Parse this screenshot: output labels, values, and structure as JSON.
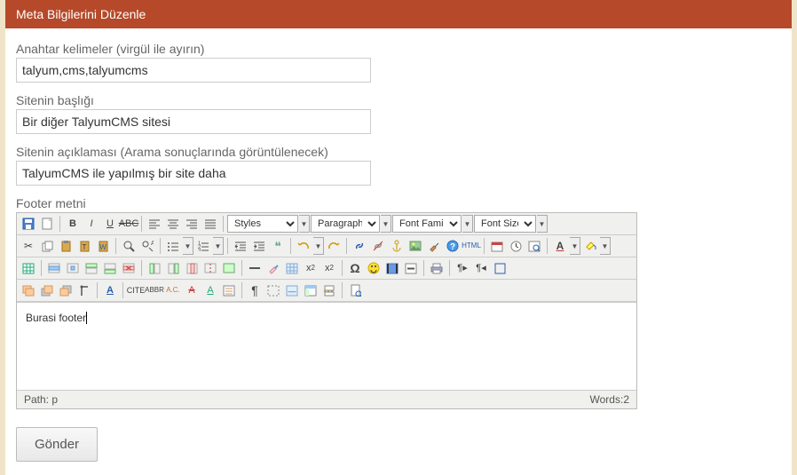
{
  "header": {
    "title": "Meta Bilgilerini Düzenle"
  },
  "fields": {
    "keywords": {
      "label": "Anahtar kelimeler (virgül ile ayırın)",
      "value": "talyum,cms,talyumcms"
    },
    "title": {
      "label": "Sitenin başlığı",
      "value": "Bir diğer TalyumCMS sitesi"
    },
    "desc": {
      "label": "Sitenin açıklaması (Arama sonuçlarında görüntülenecek)",
      "value": "TalyumCMS ile yapılmış bir site daha"
    },
    "footer": {
      "label": "Footer metni",
      "value": "Burasi footer"
    }
  },
  "editor": {
    "selects": {
      "styles": "Styles",
      "format": "Paragraph",
      "fontfamily": "Font Family",
      "fontsize": "Font Size"
    },
    "status": {
      "path": "Path: p",
      "words_label": "Words:",
      "words": "2"
    }
  },
  "submit": {
    "label": "Gönder"
  },
  "colors": {
    "accent": "#b5492a"
  }
}
